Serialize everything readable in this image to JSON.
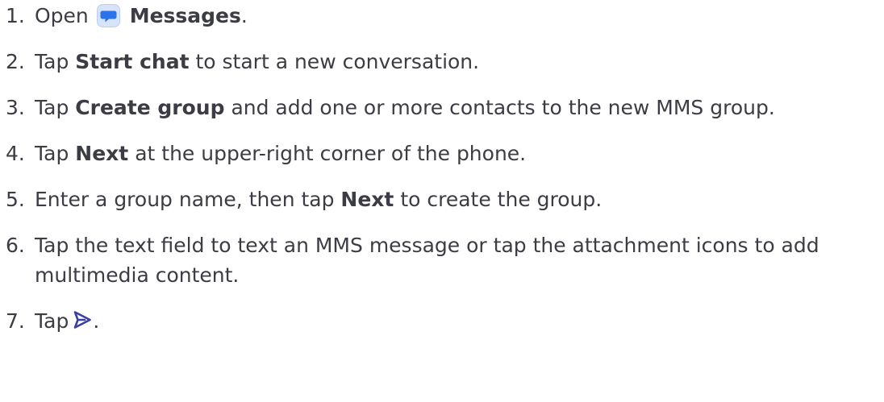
{
  "steps": [
    {
      "num": "1.",
      "pre": "Open",
      "bold": "Messages",
      "post": ".",
      "icon": "messages-app-icon"
    },
    {
      "num": "2.",
      "pre": "Tap ",
      "bold": "Start chat",
      "post": " to start a new conversation."
    },
    {
      "num": "3.",
      "pre": "Tap ",
      "bold": "Create group",
      "post": " and add one or more contacts to the new MMS group."
    },
    {
      "num": "4.",
      "pre": "Tap ",
      "bold": "Next",
      "post": " at the upper-right corner of the phone."
    },
    {
      "num": "5.",
      "pre": "Enter a group name, then tap ",
      "bold": "Next",
      "post": " to create the group."
    },
    {
      "num": "6.",
      "text": "Tap the text field to text an MMS message or tap the attachment icons to add multimedia content."
    },
    {
      "num": "7.",
      "pre": "Tap",
      "post": ".",
      "icon": "send-icon"
    }
  ],
  "colors": {
    "text": "#3c3c44",
    "messages_icon_blue": "#2b73e8",
    "messages_icon_bg": "#d6e3fb",
    "send_icon": "#3b3fa3"
  }
}
